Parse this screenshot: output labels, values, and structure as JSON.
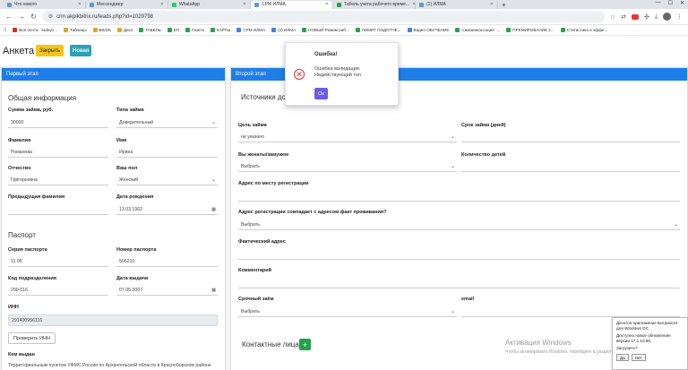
{
  "browser": {
    "tabs": [
      {
        "label": "Что нового",
        "active": false
      },
      {
        "label": "Мессенджер",
        "active": false
      },
      {
        "label": "WhatsApp",
        "active": false
      },
      {
        "label": "СРМ ИЛМА",
        "active": true
      },
      {
        "label": "Табель учета рабочего време...",
        "active": false
      },
      {
        "label": "(1) ИЛМА",
        "active": false
      }
    ],
    "url": "crm.akpikbitrix.ru/leads.php?id=1029798",
    "bookmarks": [
      "Вся почта - lodeyn...",
      "Таблицы",
      "ВК/ОК",
      "Диск",
      "ТАБЕЛЬ",
      "ЕП",
      "Газета",
      "КАРТЫ",
      "СРМ ИЛМА",
      "(2) ИЛМА",
      "НОВЫЙ Режим раб...",
      "ЛИМИТ ПОДОТЧЕ...",
      "Видео ОБУЧЕНИЕ",
      "Самоинкассация -...",
      "ПРЕМИРОВАНИЕ 2...",
      "Статистика и эффе..."
    ]
  },
  "header": {
    "title": "Анкета",
    "close_label": "Закрыть",
    "badge_new": "Новая"
  },
  "left": {
    "card_title": "Первый этап",
    "general_title": "Общая информация",
    "loan_amount_label": "Сумма займа, руб.",
    "loan_amount_value": "30000",
    "loan_type_label": "Типа займа",
    "loan_type_value": "Доверительный",
    "surname_label": "Фамилия",
    "surname_value": "Романова",
    "name_label": "Имя",
    "name_value": "Ирина",
    "patronymic_label": "Отчество",
    "patronymic_value": "Григорьевна",
    "gender_label": "Ваш пол",
    "gender_value": "Женский",
    "prev_surname_label": "Предыдущая фамилия",
    "birth_label": "Дата рождения",
    "birth_value": "13.03.1962",
    "passport_title": "Паспорт",
    "pass_series_label": "Серия паспорта",
    "pass_series_value": "11 06",
    "pass_number_label": "Номер паспорта",
    "pass_number_value": "506210",
    "dept_code_label": "Код подразделения",
    "dept_code_value": "290-016",
    "issue_date_label": "Дата выдачи",
    "issue_date_value": "07.05.2007",
    "inn_label": "ИНН",
    "inn_value": "291400956116",
    "check_inn_label": "Проверить ИНН",
    "issued_by_label": "Кем выдан",
    "issued_by_value": "Территориальным пунктом УФМС России по Архангельской области в Красноборском районе"
  },
  "right": {
    "card_title": "Второй этап",
    "income_title": "Источники до",
    "purpose_label": "Цель займа",
    "purpose_value": "не указано",
    "term_label": "Срок займа (дней)",
    "married_label": "Вы женаты/замужем",
    "married_value": "Выбрать",
    "children_label": "Количество детей",
    "reg_address_label": "Адрес по месту регистрации",
    "reg_match_label": "Адрес регистрации совпадает с адресом факт проживания?",
    "reg_match_value": "Выбрать",
    "fact_address_label": "Фактический адрес",
    "comment_label": "Комментарий",
    "urgent_label": "Срочный заём",
    "urgent_value": "Выбрать",
    "email_label": "email",
    "contacts_title": "Контактные лица",
    "add_contact_label": "+"
  },
  "modal": {
    "title": "Ошибка!",
    "message_line1": "Ошибка валидации.",
    "message_line2": "Недействующий топ",
    "ok_label": "Ок",
    "error_symbol": "✕",
    "error_color": "#e03131",
    "ok_color": "#6c5ce7"
  },
  "watermark": {
    "line1": "Активация Windows",
    "line2": "Чтобы активировать Windows, перейдите в раздел \"Параметры\"."
  },
  "notification": {
    "line1": "Десктоп-приложение Битрикс24 для Windows ОС",
    "line2": "Доступно новое обновление версии 17.1.10.86.",
    "line3": "Загрузить?",
    "yes_label": "Да",
    "no_label": "Нет"
  },
  "colors": {
    "card_header": "#1e7ee9",
    "close_button": "#f5c518",
    "new_badge": "#2aa0b8",
    "add_button": "#22a347"
  }
}
